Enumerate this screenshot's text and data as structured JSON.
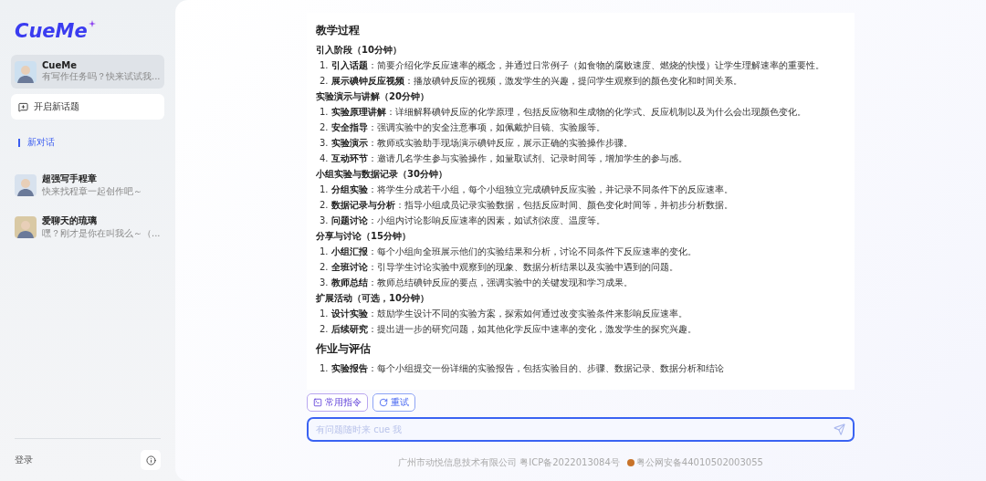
{
  "logo": "CueMe",
  "sidebar": {
    "assistants": [
      {
        "name": "CueMe",
        "subtitle": "有写作任务吗？快来试试我...",
        "selected": true
      }
    ],
    "new_topic_button": "开启新话题",
    "conversations": [
      {
        "label": "新对话",
        "selected": true
      }
    ],
    "characters": [
      {
        "name": "超强写手程章",
        "subtitle": "快来找程章一起创作吧～",
        "selected": false
      },
      {
        "name": "爱聊天的琉璃",
        "subtitle": "嘿？刚才是你在叫我么～（...",
        "selected": false
      }
    ],
    "login": "登录"
  },
  "document": {
    "sections": [
      {
        "kind": "h2",
        "title": "教学过程"
      },
      {
        "kind": "h3",
        "title": "引入阶段（10分钟）",
        "items": [
          "1. **引入话题**：简要介绍化学反应速率的概念，并通过日常例子（如食物的腐败速度、燃烧的快慢）让学生理解速率的重要性。",
          "2. **展示碘钟反应视频**：播放碘钟反应的视频，激发学生的兴趣，提问学生观察到的颜色变化和时间关系。"
        ]
      },
      {
        "kind": "h3",
        "title": "实验演示与讲解（20分钟）",
        "items": [
          "1. **实验原理讲解**：详细解释碘钟反应的化学原理，包括反应物和生成物的化学式、反应机制以及为什么会出现颜色变化。",
          "2. **安全指导**：强调实验中的安全注意事项，如佩戴护目镜、实验服等。",
          "3. **实验演示**：教师或实验助手现场演示碘钟反应，展示正确的实验操作步骤。",
          "4. **互动环节**：邀请几名学生参与实验操作，如量取试剂、记录时间等，增加学生的参与感。"
        ]
      },
      {
        "kind": "h3",
        "title": "小组实验与数据记录（30分钟）",
        "items": [
          "1. **分组实验**：将学生分成若干小组，每个小组独立完成碘钟反应实验，并记录不同条件下的反应速率。",
          "2. **数据记录与分析**：指导小组成员记录实验数据，包括反应时间、颜色变化时间等，并初步分析数据。",
          "3. **问题讨论**：小组内讨论影响反应速率的因素，如试剂浓度、温度等。"
        ]
      },
      {
        "kind": "h3",
        "title": "分享与讨论（15分钟）",
        "items": [
          "1. **小组汇报**：每个小组向全班展示他们的实验结果和分析，讨论不同条件下反应速率的变化。",
          "2. **全班讨论**：引导学生讨论实验中观察到的现象、数据分析结果以及实验中遇到的问题。",
          "3. **教师总结**：教师总结碘钟反应的要点，强调实验中的关键发现和学习成果。"
        ]
      },
      {
        "kind": "h3",
        "title": "扩展活动（可选，10分钟）",
        "items": [
          "1. **设计实验**：鼓励学生设计不同的实验方案，探索如何通过改变实验条件来影响反应速率。",
          "2. **后续研究**：提出进一步的研究问题，如其他化学反应中速率的变化，激发学生的探究兴趣。"
        ]
      },
      {
        "kind": "h2",
        "title": "作业与评估",
        "items": [
          "1. **实验报告**：每个小组提交一份详细的实验报告，包括实验目的、步骤、数据记录、数据分析和结论"
        ]
      }
    ]
  },
  "actions": [
    {
      "kind": "commands",
      "label": "常用指令"
    },
    {
      "kind": "retry",
      "label": "重试"
    }
  ],
  "input": {
    "placeholder": "有问题随时来 cue 我"
  },
  "footer": {
    "icp": "广州市动悦信息技术有限公司 粤ICP备2022013084号",
    "police": "粤公网安备44010502003055"
  }
}
